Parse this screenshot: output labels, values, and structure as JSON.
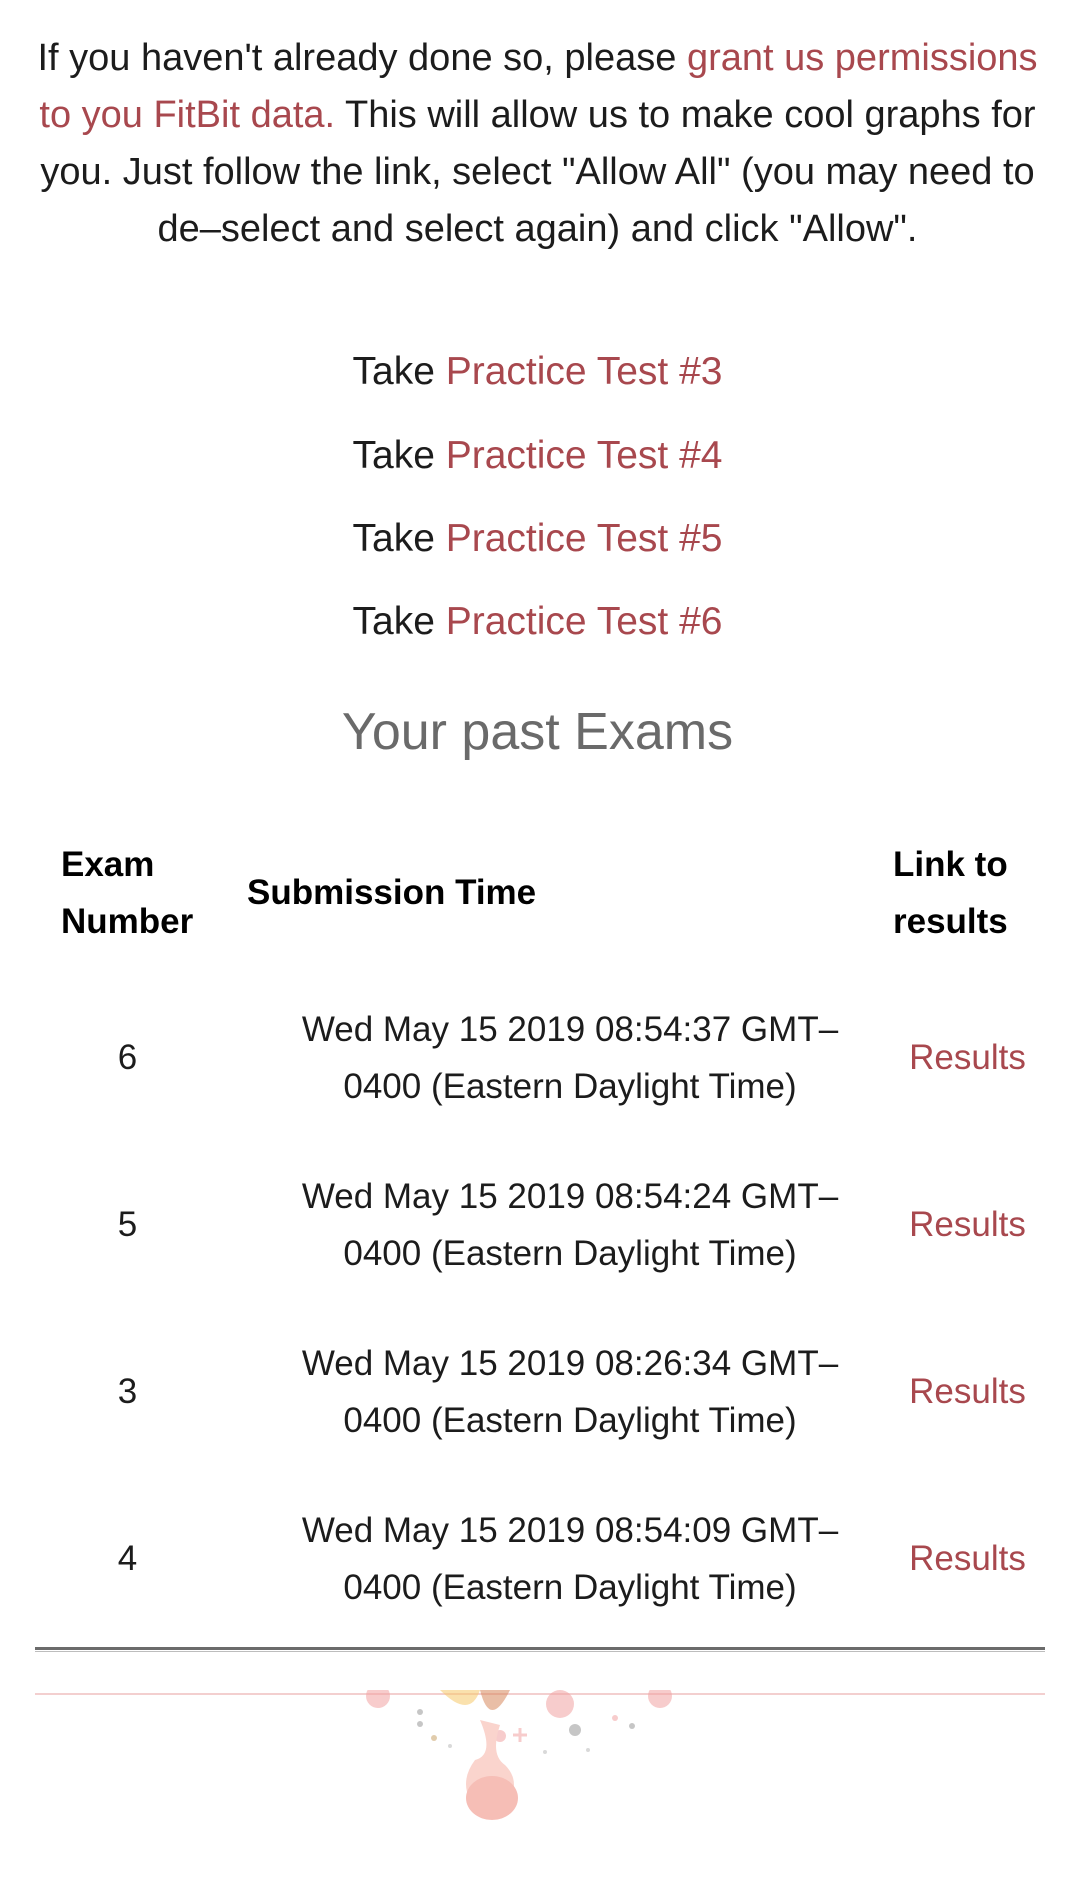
{
  "intro": {
    "before": "If you haven't already done so, please ",
    "link": "grant us permissions to you FitBit data.",
    "after": " This will allow us to make cool graphs for you. Just follow the link, select \"Allow All\" (you may need to de–select and select again) and click \"Allow\"."
  },
  "practice_prefix": "Take",
  "practice_tests": [
    "Practice Test #3",
    "Practice Test #4",
    "Practice Test #5",
    "Practice Test #6"
  ],
  "past_heading": "Your past Exams",
  "table": {
    "headers": {
      "exam_number_1": "Exam",
      "exam_number_2": "Number",
      "submission_time": "Submission Time",
      "link_1": "Link to",
      "link_2": "results"
    },
    "rows": [
      {
        "number": "6",
        "time_1": "Wed May 15 2019 08:54:37 GMT–",
        "time_2": "0400 (Eastern Daylight Time)",
        "link": "Results"
      },
      {
        "number": "5",
        "time_1": "Wed May 15 2019 08:54:24 GMT–",
        "time_2": "0400 (Eastern Daylight Time)",
        "link": "Results"
      },
      {
        "number": "3",
        "time_1": "Wed May 15 2019 08:26:34 GMT–",
        "time_2": "0400 (Eastern Daylight Time)",
        "link": "Results"
      },
      {
        "number": "4",
        "time_1": "Wed May 15 2019 08:54:09 GMT–",
        "time_2": "0400 (Eastern Daylight Time)",
        "link": "Results"
      }
    ]
  },
  "colors": {
    "link": "#a8484e",
    "heading": "#6a6a6a",
    "text": "#1c1c1c"
  }
}
